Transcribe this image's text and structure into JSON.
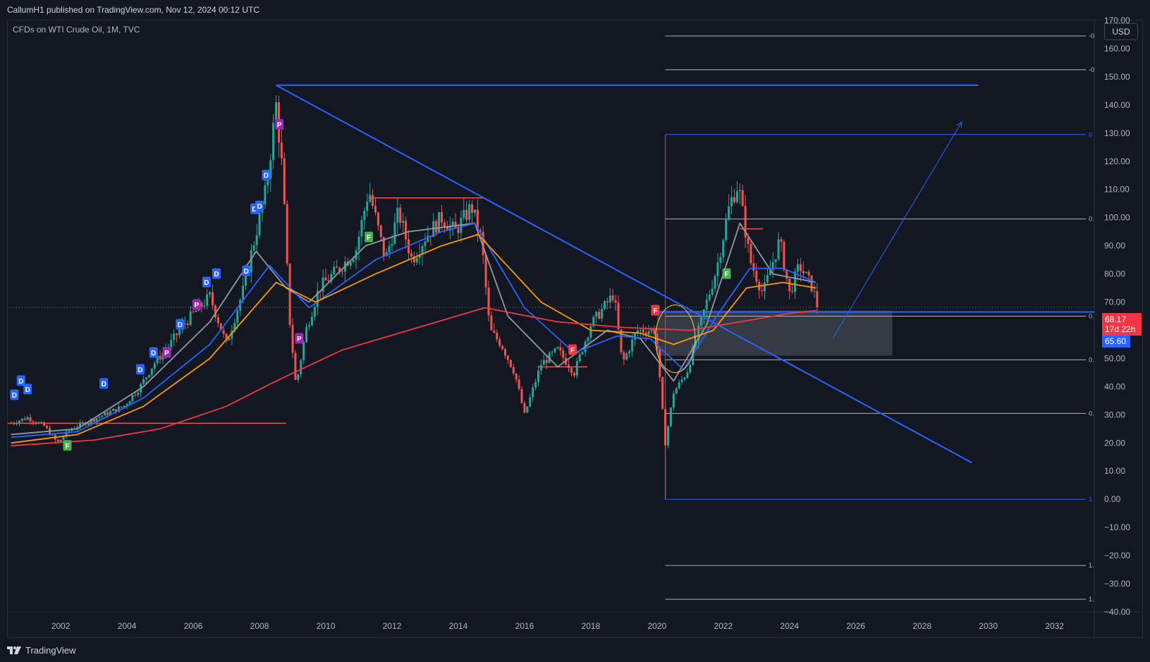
{
  "header": {
    "publisher": "CallumH1 published on TradingView.com, Nov 12, 2024 00:12 UTC"
  },
  "symbol": {
    "label": "CFDs on WTI Crude Oil, 1M, TVC"
  },
  "currency": "USD",
  "price_tag": {
    "price": "68.17",
    "countdown": "17d 22h"
  },
  "blue_tag": "65.60",
  "footer": {
    "brand": "TradingView",
    "logo_icon": "tradingview-logo-icon"
  },
  "colors": {
    "background": "#131722",
    "up": "#26a69a",
    "down": "#ef5350",
    "trendline": "#2962ff",
    "fib_gray": "#b2b5be",
    "ma_gray": "#9598a1",
    "ma_blue": "#2962ff",
    "ma_orange": "#ff9800",
    "ma_red": "#f23645"
  },
  "chart_data": {
    "type": "candlestick",
    "x_axis": {
      "range": [
        2000.4,
        2033.2
      ],
      "ticks": [
        "2002",
        "2004",
        "2006",
        "2008",
        "2010",
        "2012",
        "2014",
        "2016",
        "2018",
        "2020",
        "2022",
        "2024",
        "2026",
        "2028",
        "2030",
        "2032"
      ]
    },
    "y_axis": {
      "range": [
        -40,
        170
      ],
      "ticks": [
        "170.00",
        "160.00",
        "150.00",
        "140.00",
        "130.00",
        "120.00",
        "110.00",
        "100.00",
        "90.00",
        "80.00",
        "70.00",
        "60.00",
        "50.00",
        "40.00",
        "30.00",
        "20.00",
        "10.00",
        "0.00",
        "−10.00",
        "−20.00",
        "−30.00",
        "−40.00"
      ]
    },
    "price_path": [
      [
        2000.5,
        27
      ],
      [
        2001.0,
        29
      ],
      [
        2001.5,
        26
      ],
      [
        2001.9,
        20
      ],
      [
        2002.3,
        25
      ],
      [
        2002.9,
        28
      ],
      [
        2003.3,
        30
      ],
      [
        2003.9,
        33
      ],
      [
        2004.4,
        40
      ],
      [
        2004.8,
        48
      ],
      [
        2005.3,
        55
      ],
      [
        2005.7,
        62
      ],
      [
        2006.5,
        72
      ],
      [
        2007.0,
        55
      ],
      [
        2007.5,
        74
      ],
      [
        2007.9,
        95
      ],
      [
        2008.2,
        110
      ],
      [
        2008.5,
        140
      ],
      [
        2008.7,
        115
      ],
      [
        2008.9,
        65
      ],
      [
        2009.1,
        40
      ],
      [
        2009.4,
        60
      ],
      [
        2009.8,
        75
      ],
      [
        2010.4,
        82
      ],
      [
        2010.9,
        88
      ],
      [
        2011.3,
        110
      ],
      [
        2011.8,
        85
      ],
      [
        2012.2,
        102
      ],
      [
        2012.6,
        85
      ],
      [
        2013.0,
        93
      ],
      [
        2013.5,
        100
      ],
      [
        2013.9,
        95
      ],
      [
        2014.4,
        104
      ],
      [
        2014.7,
        92
      ],
      [
        2014.95,
        60
      ],
      [
        2015.3,
        55
      ],
      [
        2015.7,
        45
      ],
      [
        2016.0,
        30
      ],
      [
        2016.5,
        48
      ],
      [
        2017.0,
        53
      ],
      [
        2017.5,
        45
      ],
      [
        2018.0,
        62
      ],
      [
        2018.7,
        73
      ],
      [
        2018.95,
        48
      ],
      [
        2019.4,
        60
      ],
      [
        2019.95,
        60
      ],
      [
        2020.25,
        20
      ],
      [
        2020.5,
        38
      ],
      [
        2020.9,
        45
      ],
      [
        2021.3,
        62
      ],
      [
        2021.8,
        82
      ],
      [
        2022.2,
        105
      ],
      [
        2022.45,
        112
      ],
      [
        2022.8,
        85
      ],
      [
        2023.2,
        73
      ],
      [
        2023.7,
        92
      ],
      [
        2024.0,
        73
      ],
      [
        2024.3,
        83
      ],
      [
        2024.7,
        75
      ],
      [
        2024.85,
        68
      ]
    ],
    "moving_averages": [
      {
        "color": "ma_gray",
        "points": [
          [
            2000.5,
            23
          ],
          [
            2002.5,
            25
          ],
          [
            2004.5,
            40
          ],
          [
            2006.5,
            63
          ],
          [
            2007.9,
            88
          ],
          [
            2008.8,
            75
          ],
          [
            2009.5,
            70
          ],
          [
            2011.2,
            90
          ],
          [
            2012.5,
            95
          ],
          [
            2014.5,
            98
          ],
          [
            2015.5,
            65
          ],
          [
            2017.0,
            47
          ],
          [
            2018.5,
            60
          ],
          [
            2019.5,
            57
          ],
          [
            2020.5,
            42
          ],
          [
            2021.5,
            62
          ],
          [
            2022.5,
            98
          ],
          [
            2023.5,
            80
          ],
          [
            2024.8,
            77
          ]
        ]
      },
      {
        "color": "ma_blue",
        "points": [
          [
            2000.5,
            22
          ],
          [
            2002.5,
            24
          ],
          [
            2004.5,
            36
          ],
          [
            2006.5,
            55
          ],
          [
            2008.3,
            83
          ],
          [
            2009.5,
            68
          ],
          [
            2011.5,
            85
          ],
          [
            2013.5,
            95
          ],
          [
            2014.5,
            98
          ],
          [
            2016.0,
            68
          ],
          [
            2017.5,
            52
          ],
          [
            2018.8,
            58
          ],
          [
            2019.8,
            57
          ],
          [
            2020.8,
            46
          ],
          [
            2021.8,
            65
          ],
          [
            2022.8,
            82
          ],
          [
            2023.8,
            82
          ],
          [
            2024.8,
            77
          ]
        ]
      },
      {
        "color": "ma_orange",
        "points": [
          [
            2000.5,
            20
          ],
          [
            2002.5,
            23
          ],
          [
            2004.5,
            33
          ],
          [
            2006.5,
            50
          ],
          [
            2008.5,
            77
          ],
          [
            2009.7,
            70
          ],
          [
            2011.5,
            80
          ],
          [
            2013.5,
            90
          ],
          [
            2014.6,
            94
          ],
          [
            2016.5,
            70
          ],
          [
            2018.0,
            60
          ],
          [
            2019.5,
            59
          ],
          [
            2020.5,
            55
          ],
          [
            2021.7,
            60
          ],
          [
            2022.7,
            75
          ],
          [
            2023.8,
            77
          ],
          [
            2024.8,
            75
          ]
        ]
      },
      {
        "color": "ma_red",
        "points": [
          [
            2000.5,
            19
          ],
          [
            2003.0,
            21
          ],
          [
            2005.0,
            25
          ],
          [
            2007.0,
            33
          ],
          [
            2008.5,
            42
          ],
          [
            2010.5,
            53
          ],
          [
            2012.5,
            60
          ],
          [
            2014.8,
            68
          ],
          [
            2017.0,
            63
          ],
          [
            2019.0,
            61
          ],
          [
            2021.0,
            60
          ],
          [
            2022.5,
            63
          ],
          [
            2024.0,
            66
          ],
          [
            2024.8,
            67
          ]
        ]
      }
    ],
    "trendlines": [
      {
        "from": [
          2008.5,
          147
        ],
        "to": [
          2029.5,
          13
        ],
        "width": 2
      },
      {
        "from": [
          2008.5,
          147
        ],
        "to": [
          2029.7,
          147
        ],
        "width": 2
      },
      {
        "from": [
          2025.3,
          57
        ],
        "to": [
          2029.2,
          134
        ],
        "width": 1,
        "arrow": true
      }
    ],
    "fib_levels": [
      {
        "price": 164.5,
        "label": "-0",
        "color": "fib_gray"
      },
      {
        "price": 152.5,
        "label": "-0",
        "color": "fib_gray"
      },
      {
        "price": 129.5,
        "label": "0",
        "color": "trendline"
      },
      {
        "price": 99.5,
        "label": "0.",
        "color": "fib_gray"
      },
      {
        "price": 65.0,
        "label": "0.",
        "color": "fib_gray"
      },
      {
        "price": 49.5,
        "label": "0.",
        "color": "fib_gray"
      },
      {
        "price": 30.5,
        "label": "0.",
        "color": "fib_gray"
      },
      {
        "price": 0.0,
        "label": "1",
        "color": "trendline"
      },
      {
        "price": -23.5,
        "label": "1.",
        "color": "fib_gray"
      },
      {
        "price": -35.5,
        "label": "1.",
        "color": "fib_gray"
      }
    ],
    "fib_start_x": 2020.25,
    "support_line": {
      "price": 66.5,
      "from": 2020.0,
      "to": 2033.2
    },
    "zone_box": {
      "x": [
        2020.0,
        2027.1
      ],
      "price": [
        51,
        67
      ]
    },
    "red_levels": [
      {
        "price": 27,
        "from": 2000.4,
        "to": 2008.8
      },
      {
        "price": 107,
        "from": 2011.3,
        "to": 2014.8
      },
      {
        "price": 47,
        "from": 2016.4,
        "to": 2017.9
      },
      {
        "price": 96,
        "from": 2022.5,
        "to": 2023.2
      }
    ],
    "ellipse": {
      "center": [
        2020.55,
        57
      ],
      "rx_years": 0.6,
      "ry_price": 12
    },
    "current_price": 68.17,
    "signals": [
      {
        "kind": "D",
        "x": 2000.6,
        "price": 37
      },
      {
        "kind": "D",
        "x": 2000.8,
        "price": 42
      },
      {
        "kind": "D",
        "x": 2001.0,
        "price": 39
      },
      {
        "kind": "F",
        "x": 2002.2,
        "price": 19
      },
      {
        "kind": "D",
        "x": 2003.3,
        "price": 41
      },
      {
        "kind": "D",
        "x": 2004.4,
        "price": 46
      },
      {
        "kind": "D",
        "x": 2004.8,
        "price": 52
      },
      {
        "kind": "P",
        "x": 2005.2,
        "price": 52
      },
      {
        "kind": "D",
        "x": 2005.6,
        "price": 62
      },
      {
        "kind": "P",
        "x": 2006.1,
        "price": 69
      },
      {
        "kind": "D",
        "x": 2006.4,
        "price": 77
      },
      {
        "kind": "D",
        "x": 2006.7,
        "price": 80
      },
      {
        "kind": "D",
        "x": 2007.6,
        "price": 81
      },
      {
        "kind": "D",
        "x": 2007.85,
        "price": 103
      },
      {
        "kind": "D",
        "x": 2008.0,
        "price": 104
      },
      {
        "kind": "D",
        "x": 2008.2,
        "price": 115
      },
      {
        "kind": "P",
        "x": 2008.6,
        "price": 133
      },
      {
        "kind": "P",
        "x": 2009.2,
        "price": 57
      },
      {
        "kind": "F",
        "x": 2011.3,
        "price": 93
      },
      {
        "kind": "F",
        "x": 2017.45,
        "price": 53
      },
      {
        "kind": "F",
        "x": 2019.95,
        "price": 67
      },
      {
        "kind": "F",
        "x": 2022.1,
        "price": 80
      }
    ]
  }
}
